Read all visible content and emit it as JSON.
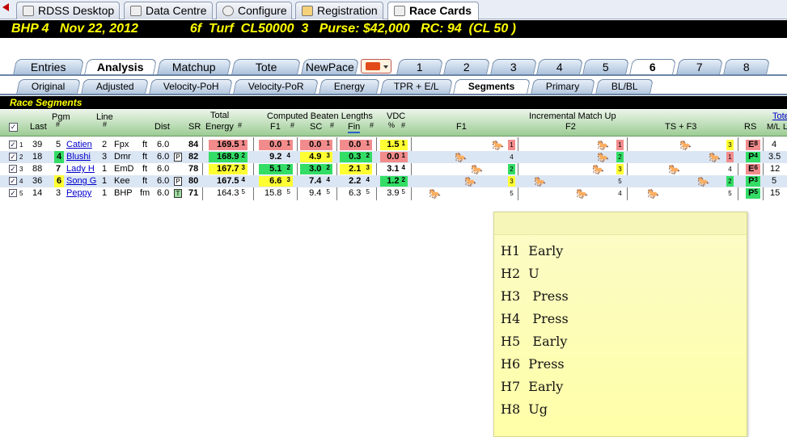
{
  "top_tabs": [
    {
      "label": "RDSS Desktop",
      "icon": "horse-icon"
    },
    {
      "label": "Data Centre",
      "icon": "database-icon"
    },
    {
      "label": "Configure",
      "icon": "gear-icon"
    },
    {
      "label": "Registration",
      "icon": "registration-icon"
    },
    {
      "label": "Race Cards",
      "icon": "racecard-icon",
      "active": true
    }
  ],
  "race_header": {
    "track": "BHP",
    "race": "4",
    "date": "Nov 22, 2012",
    "conditions": "6f  Turf  CL50000  3",
    "purse": "Purse: $42,000",
    "rc": "RC: 94  (CL 50 )"
  },
  "analysis_tabs": [
    "Entries",
    "Analysis",
    "Matchup",
    "Tote",
    "NewPace"
  ],
  "race_numbers": [
    "1",
    "2",
    "3",
    "4",
    "5",
    "6",
    "7",
    "8"
  ],
  "active_race": "6",
  "sub_tabs": [
    "Original",
    "Adjusted",
    "Velocity-PoH",
    "Velocity-PoR",
    "Energy",
    "TPR + E/L",
    "Segments",
    "Primary",
    "BL/BL"
  ],
  "active_sub_tab": "Segments",
  "section_title": "Race Segments",
  "columns": {
    "last": "Last",
    "pgm": "Pgm",
    "hash": "#",
    "line": "Line",
    "dist": "Dist",
    "sr": "SR",
    "total": "Total",
    "energy": "Energy",
    "cbl": "Computed Beaten Lengths",
    "f1": "F1",
    "sc": "SC",
    "fin": "Fin",
    "vdc": "VDC",
    "pct": "%",
    "imu": "Incremental Match Up",
    "imu_f1": "F1",
    "imu_f2": "F2",
    "imu_ts": "TS + F3",
    "rs": "RS",
    "tote": "Tote",
    "ml": "M/L",
    "l": "L"
  },
  "rows": [
    {
      "idx": "1",
      "last": "39",
      "pgm": "5",
      "name": "Catien",
      "line": "2",
      "trk": "Fpx",
      "surf": "ft",
      "dist": "6.0",
      "surface_mark": "",
      "sr": "84",
      "energy": "169.5",
      "energy_rank": "1",
      "f1": "0.0",
      "f1_rank": "1",
      "sc": "0.0",
      "sc_rank": "1",
      "fin": "0.0",
      "fin_rank": "1",
      "vdc": "1.5",
      "vdc_rank": "1",
      "rs": "E",
      "rs_rank": "8",
      "ml": "4",
      "f1_flag": "1",
      "f2_flag": "1",
      "ts_flag": "3"
    },
    {
      "idx": "2",
      "last": "18",
      "pgm": "4",
      "name": "Blushi",
      "line": "3",
      "trk": "Dmr",
      "surf": "ft",
      "dist": "6.0",
      "surface_mark": "P",
      "sr": "82",
      "energy": "168.9",
      "energy_rank": "2",
      "f1": "9.2",
      "f1_rank": "4",
      "sc": "4.9",
      "sc_rank": "3",
      "fin": "0.3",
      "fin_rank": "2",
      "vdc": "0.0",
      "vdc_rank": "1",
      "rs": "P",
      "rs_rank": "4",
      "ml": "3.5",
      "f1_flag": "4",
      "f2_flag": "2",
      "ts_flag": "1"
    },
    {
      "idx": "3",
      "last": "88",
      "pgm": "7",
      "name": "Lady H",
      "line": "1",
      "trk": "EmD",
      "surf": "ft",
      "dist": "6.0",
      "surface_mark": "",
      "sr": "78",
      "energy": "167.7",
      "energy_rank": "3",
      "f1": "5.1",
      "f1_rank": "2",
      "sc": "3.0",
      "sc_rank": "2",
      "fin": "2.1",
      "fin_rank": "3",
      "vdc": "3.1",
      "vdc_rank": "4",
      "rs": "E",
      "rs_rank": "6",
      "ml": "12",
      "f1_flag": "2",
      "f2_flag": "3",
      "ts_flag": "4"
    },
    {
      "idx": "4",
      "last": "36",
      "pgm": "6",
      "name": "Song G",
      "line": "1",
      "trk": "Kee",
      "surf": "ft",
      "dist": "6.0",
      "surface_mark": "P",
      "sr": "80",
      "energy": "167.5",
      "energy_rank": "4",
      "f1": "6.6",
      "f1_rank": "3",
      "sc": "7.4",
      "sc_rank": "4",
      "fin": "2.2",
      "fin_rank": "4",
      "vdc": "1.2",
      "vdc_rank": "2",
      "rs": "P",
      "rs_rank": "3",
      "ml": "5",
      "f1_flag": "3",
      "f2_flag": "5",
      "ts_flag": "2"
    },
    {
      "idx": "5",
      "last": "14",
      "pgm": "3",
      "name": "Peppy",
      "line": "1",
      "trk": "BHP",
      "surf": "fm",
      "dist": "6.0",
      "surface_mark": "T",
      "sr": "71",
      "energy": "164.3",
      "energy_rank": "5",
      "f1": "15.8",
      "f1_rank": "5",
      "sc": "9.4",
      "sc_rank": "5",
      "fin": "6.3",
      "fin_rank": "5",
      "vdc": "3.9",
      "vdc_rank": "5",
      "rs": "P",
      "rs_rank": "5",
      "ml": "15",
      "f1_flag": "5",
      "f2_flag": "4",
      "ts_flag": "5"
    }
  ],
  "note_lines": [
    "H1  Early",
    "H2  U",
    "H3   Press",
    "H4   Press",
    "H5   Early",
    "H6  Press",
    "H7  Early",
    "H8  Ug"
  ],
  "colors": {
    "header_bg": "#000000",
    "header_text": "#ffff00",
    "rank1": "#f28c8c",
    "rank_mid": "#ffff33",
    "rank_good": "#33dd66",
    "note_bg": "#ffffa8"
  }
}
